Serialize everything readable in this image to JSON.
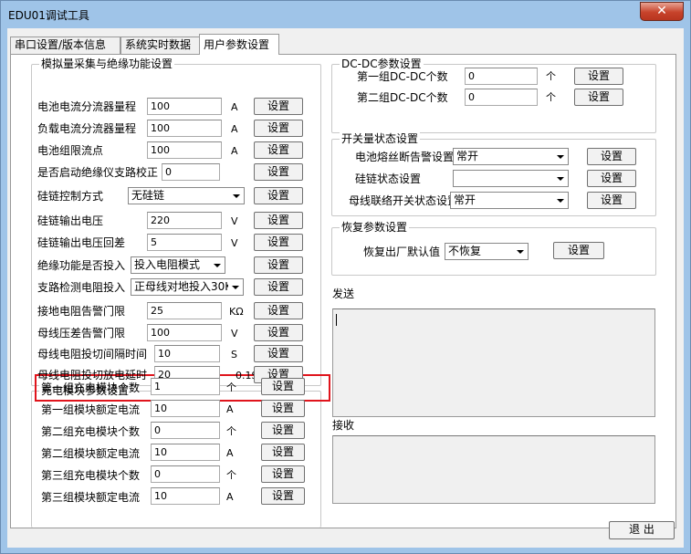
{
  "window": {
    "title": "EDU01调试工具",
    "close_glyph": "✕"
  },
  "tabs": [
    {
      "label": "串口设置/版本信息"
    },
    {
      "label": "系统实时数据"
    },
    {
      "label": "用户参数设置"
    }
  ],
  "analog": {
    "title": "模拟量采集与绝缘功能设置",
    "rows": [
      {
        "label": "电池电流分流器量程",
        "value": "100",
        "unit": "A",
        "button": "设置"
      },
      {
        "label": "负载电流分流器量程",
        "value": "100",
        "unit": "A",
        "button": "设置"
      },
      {
        "label": "电池组限流点",
        "value": "100",
        "unit": "A",
        "button": "设置"
      },
      {
        "label": "是否启动绝缘仪支路校正",
        "value": "0",
        "unit": "",
        "button": "设置"
      },
      {
        "label": "硅链控制方式",
        "select": "无硅链",
        "button": "设置"
      },
      {
        "label": "硅链输出电压",
        "value": "220",
        "unit": "V",
        "button": "设置"
      },
      {
        "label": "硅链输出电压回差",
        "value": "5",
        "unit": "V",
        "button": "设置"
      },
      {
        "label": "绝缘功能是否投入",
        "select": "投入电阻模式",
        "button": "设置"
      },
      {
        "label": "支路检测电阻投入",
        "select": "正母线对地投入30K",
        "button": "设置"
      },
      {
        "label": "接地电阻告警门限",
        "value": "25",
        "unit": "KΩ",
        "button": "设置"
      },
      {
        "label": "母线压差告警门限",
        "value": "100",
        "unit": "V",
        "button": "设置"
      },
      {
        "label": "母线电阻投切间隔时间",
        "value": "10",
        "unit": "S",
        "button": "设置"
      },
      {
        "label": "母线电阻投切放电延时",
        "value": "20",
        "unit": "0.1S",
        "button": "设置"
      }
    ]
  },
  "charging": {
    "title": "充电模块参数设置",
    "rows": [
      {
        "label": "第一组充电模块个数",
        "value": "1",
        "unit": "个",
        "button": "设置"
      },
      {
        "label": "第一组模块额定电流",
        "value": "10",
        "unit": "A",
        "button": "设置"
      },
      {
        "label": "第二组充电模块个数",
        "value": "0",
        "unit": "个",
        "button": "设置"
      },
      {
        "label": "第二组模块额定电流",
        "value": "10",
        "unit": "A",
        "button": "设置"
      },
      {
        "label": "第三组充电模块个数",
        "value": "0",
        "unit": "个",
        "button": "设置"
      },
      {
        "label": "第三组模块额定电流",
        "value": "10",
        "unit": "A",
        "button": "设置"
      }
    ]
  },
  "dcdc": {
    "title": "DC-DC参数设置",
    "rows": [
      {
        "label": "第一组DC-DC个数",
        "value": "0",
        "unit": "个",
        "button": "设置"
      },
      {
        "label": "第二组DC-DC个数",
        "value": "0",
        "unit": "个",
        "button": "设置"
      }
    ]
  },
  "switch": {
    "title": "开关量状态设置",
    "rows": [
      {
        "label": "电池熔丝断告警设置",
        "select": "常开",
        "button": "设置"
      },
      {
        "label": "硅链状态设置",
        "select": "",
        "button": "设置"
      },
      {
        "label": "母线联络开关状态设置",
        "select": "常开",
        "button": "设置"
      }
    ]
  },
  "restore": {
    "title": "恢复参数设置",
    "label": "恢复出厂默认值",
    "select": "不恢复",
    "button": "设置"
  },
  "send": {
    "label": "发送"
  },
  "receive": {
    "label": "接收"
  },
  "exit_button": "退 出"
}
